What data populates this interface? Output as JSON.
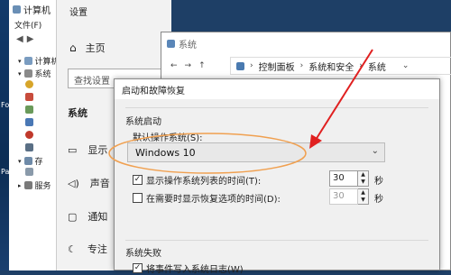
{
  "desktop": {
    "text1": "For",
    "text2": "Pa"
  },
  "computer_management": {
    "title": "计算机",
    "menu_file": "文件(F)",
    "tree": [
      {
        "label": "计算机"
      },
      {
        "label": "系统"
      },
      {
        "label": ""
      },
      {
        "label": ""
      },
      {
        "label": ""
      },
      {
        "label": ""
      },
      {
        "label": ""
      },
      {
        "label": ""
      },
      {
        "label": ""
      },
      {
        "label": "存"
      },
      {
        "label": ""
      },
      {
        "label": "服务"
      }
    ]
  },
  "settings": {
    "title": "设置",
    "home_label": "主页",
    "search_placeholder": "查找设置",
    "section": "系统",
    "items": [
      {
        "label": "显示"
      },
      {
        "label": "声音"
      },
      {
        "label": "通知"
      },
      {
        "label": "专注"
      }
    ]
  },
  "system_window": {
    "title": "系统",
    "breadcrumbs": [
      "控制面板",
      "系统和安全",
      "系统"
    ]
  },
  "dialog": {
    "title": "启动和故障恢复",
    "group_startup": "系统启动",
    "default_os_label": "默认操作系统(S):",
    "default_os_value": "Windows 10",
    "show_list_label": "显示操作系统列表的时间(T):",
    "show_list_checked": true,
    "show_list_value": "30",
    "show_recovery_label": "在需要时显示恢复选项的时间(D):",
    "show_recovery_checked": false,
    "show_recovery_value": "30",
    "seconds_unit": "秒",
    "group_failure": "系统失败",
    "write_event_label": "将事件写入系统日志(W)",
    "write_event_checked": true
  },
  "colors": {
    "highlight_ellipse": "#f0a050",
    "annotation_arrow": "#e02020",
    "desktop_bg": "#123a6b"
  }
}
